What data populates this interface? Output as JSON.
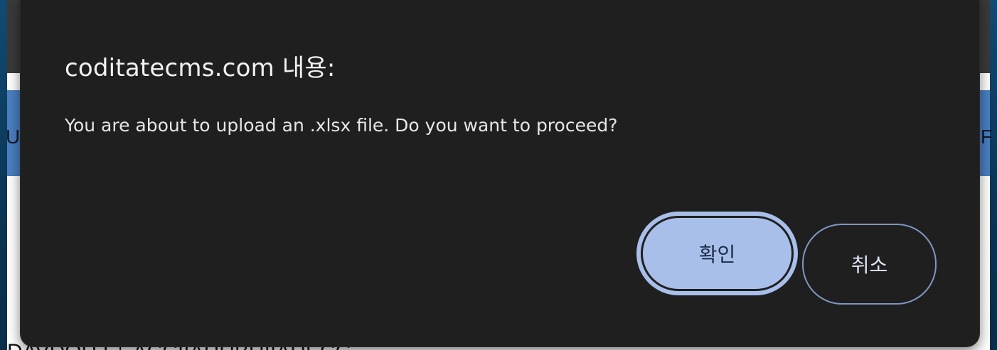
{
  "background_page": {
    "header_edge_left": "U",
    "header_edge_right": "F",
    "bottom_text": "DAVDOU I  │ ACCIIAHUBUIIAUECC"
  },
  "dialog": {
    "title": "coditatecms.com 내용:",
    "message": "You are about to upload an .xlsx file. Do you want to proceed?",
    "ok_label": "확인",
    "cancel_label": "취소"
  },
  "colors": {
    "dialog_bg": "#1f1f1f",
    "ok_button_bg": "#a8bfea",
    "cancel_border": "#7f96c2",
    "page_header_band": "#4a7fc0"
  }
}
